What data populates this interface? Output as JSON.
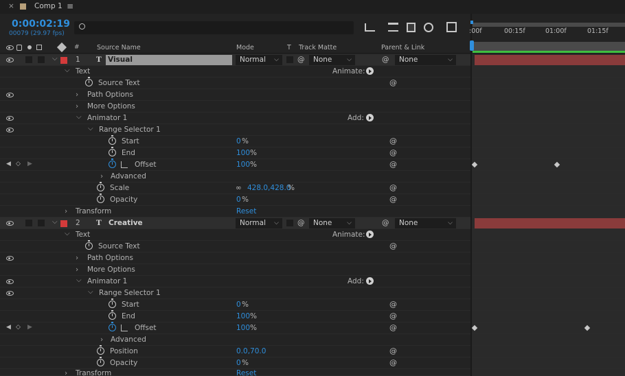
{
  "tab": {
    "close": "×",
    "title": "Comp 1",
    "menu": "≡"
  },
  "timecode": "0:00:02:19",
  "frame_info": "00079 (29.97 fps)",
  "search": {
    "placeholder": ""
  },
  "header": {
    "num": "#",
    "source_name": "Source Name",
    "mode": "Mode",
    "t": "T",
    "track_matte": "Track Matte",
    "parent_link": "Parent & Link"
  },
  "ruler": {
    "labels": [
      ":00f",
      "00:15f",
      "01:00f",
      "01:15f"
    ]
  },
  "layers": [
    {
      "num": "1",
      "type_icon": "T",
      "name": "Visual",
      "mode": "Normal",
      "matte": "None",
      "parent": "None",
      "text": "Text",
      "animate": "Animate:",
      "source_text": "Source Text",
      "path_options": "Path Options",
      "more_options": "More Options",
      "animator": "Animator 1",
      "add": "Add:",
      "range_selector": "Range Selector 1",
      "start": "Start",
      "start_val": "0",
      "start_unit": "%",
      "end": "End",
      "end_val": "100",
      "end_unit": "%",
      "offset": "Offset",
      "offset_val": "100",
      "offset_unit": "%",
      "advanced": "Advanced",
      "prop3": "Scale",
      "prop3_val": "428.0,428.0",
      "prop3_unit": "%",
      "opacity": "Opacity",
      "opacity_val": "0",
      "opacity_unit": "%",
      "transform": "Transform",
      "reset": "Reset"
    },
    {
      "num": "2",
      "type_icon": "T",
      "name": "Creative",
      "mode": "Normal",
      "matte": "None",
      "parent": "None",
      "text": "Text",
      "animate": "Animate:",
      "source_text": "Source Text",
      "path_options": "Path Options",
      "more_options": "More Options",
      "animator": "Animator 1",
      "add": "Add:",
      "range_selector": "Range Selector 1",
      "start": "Start",
      "start_val": "0",
      "start_unit": "%",
      "end": "End",
      "end_val": "100",
      "end_unit": "%",
      "offset": "Offset",
      "offset_val": "100",
      "offset_unit": "%",
      "advanced": "Advanced",
      "prop3": "Position",
      "prop3_val": "0.0,70.0",
      "prop3_unit": "",
      "opacity": "Opacity",
      "opacity_val": "0",
      "opacity_unit": "%",
      "transform": "Transform",
      "reset": "Reset"
    }
  ],
  "colors": {
    "accent": "#2f8fdd",
    "label_red": "#d33b3b",
    "layer_bar": "#8a3b3b",
    "work_area": "#3fbf3f"
  }
}
